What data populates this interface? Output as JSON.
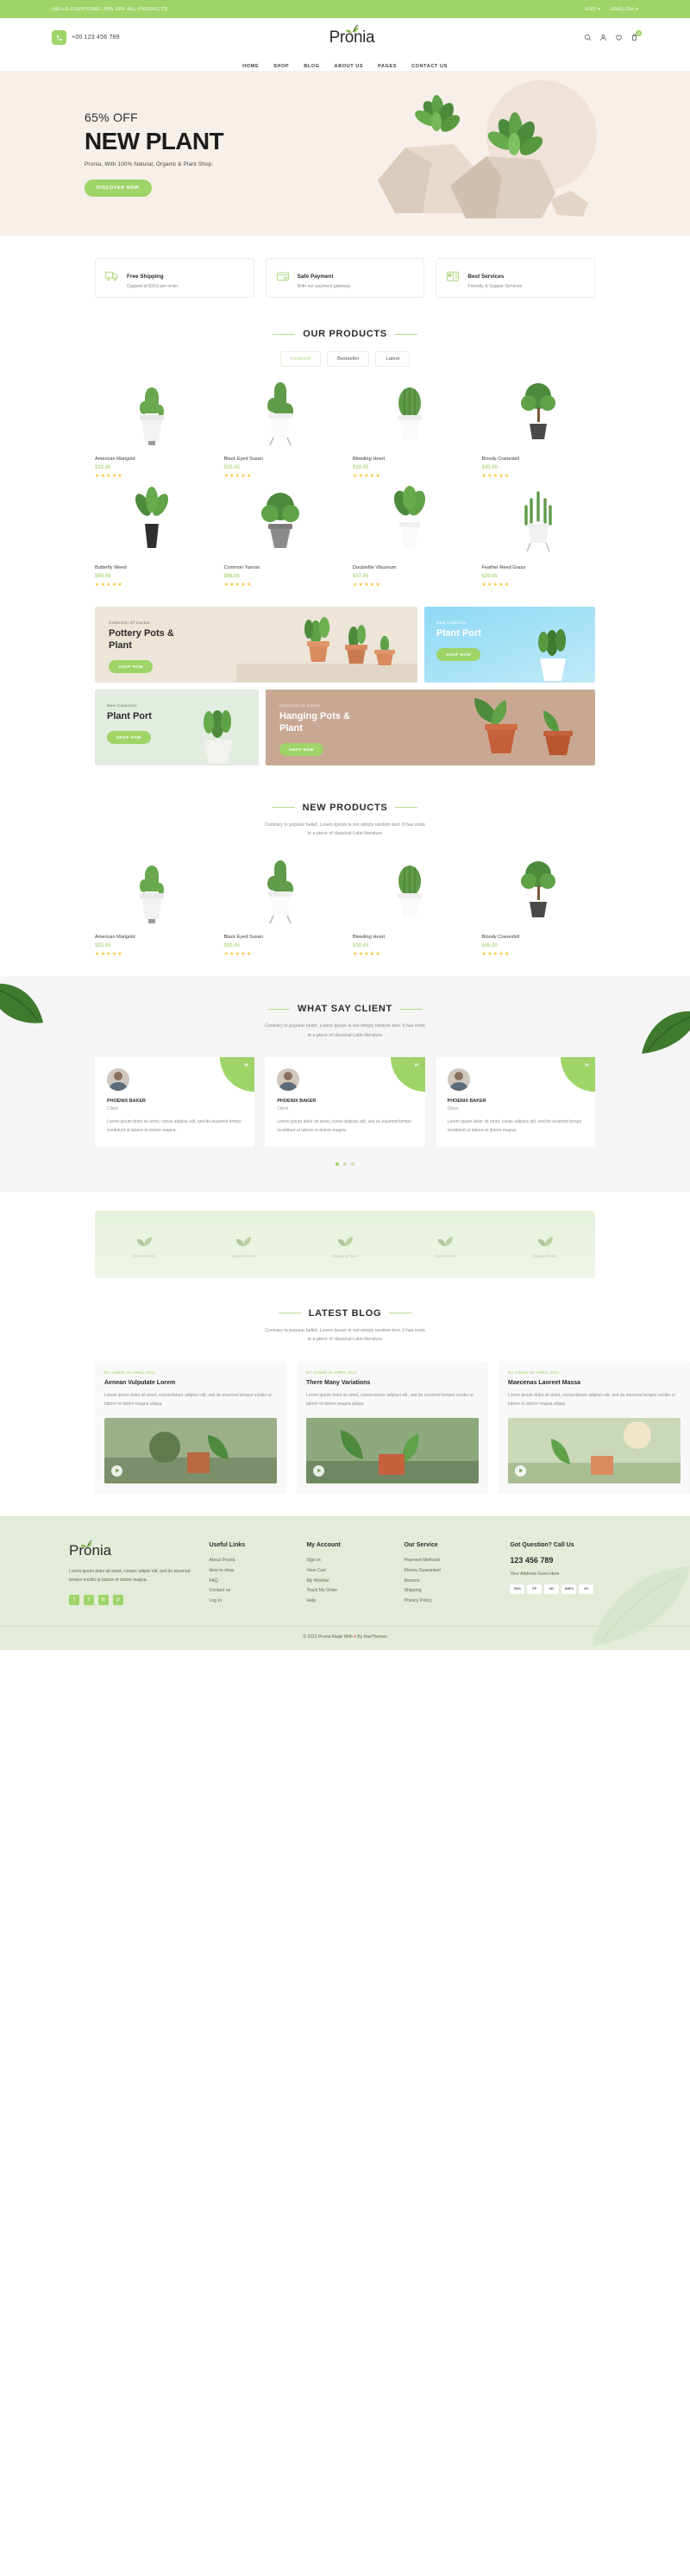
{
  "topbar": {
    "announcement": "HELLO EVERYONE! 25% OFF ALL PRODUCTS",
    "currency": "USD",
    "language": "ENGLISH",
    "caret": "▾"
  },
  "header": {
    "phone": "+00 123 456 789",
    "logo": "Pronia",
    "cart_count": "0",
    "icons": [
      "search-icon",
      "user-icon",
      "wishlist-icon",
      "cart-icon"
    ]
  },
  "nav": {
    "items": [
      {
        "label": "HOME"
      },
      {
        "label": "SHOP"
      },
      {
        "label": "BLOG"
      },
      {
        "label": "ABOUT US"
      },
      {
        "label": "PAGES"
      },
      {
        "label": "CONTACT US"
      }
    ]
  },
  "hero": {
    "offer": "65% OFF",
    "title": "NEW PLANT",
    "subtitle": "Pronia, With 100% Natural, Organic & Plant Shop.",
    "cta": "DISCOVER NOW",
    "bg": "#f7efe9"
  },
  "services": [
    {
      "icon": "truck-icon",
      "title": "Free Shipping",
      "desc": "Capped at $319 per order"
    },
    {
      "icon": "credit-card-icon",
      "title": "Safe Payment",
      "desc": "With our payment gateway"
    },
    {
      "icon": "support-icon",
      "title": "Best Services",
      "desc": "Friendly & Supper Services"
    }
  ],
  "products_section": {
    "title": "OUR PRODUCTS",
    "tabs": [
      {
        "label": "Featured",
        "active": true
      },
      {
        "label": "Bestseller",
        "active": false
      },
      {
        "label": "Latest",
        "active": false
      }
    ],
    "items": [
      {
        "name": "American Marigold",
        "price": "$23.45",
        "stars": "★★★★★"
      },
      {
        "name": "Black Eyed Susan",
        "price": "$25.45",
        "stars": "★★★★★"
      },
      {
        "name": "Bleeding Heart",
        "price": "$30.45",
        "stars": "★★★★★"
      },
      {
        "name": "Bloody Cranesbill",
        "price": "$45.00",
        "stars": "★★★★★"
      },
      {
        "name": "Butterfly Weed",
        "price": "$60.45",
        "stars": "★★★★★"
      },
      {
        "name": "Common Yarrow",
        "price": "$68.05",
        "stars": "★★★★★"
      },
      {
        "name": "Doublefile Viburnum",
        "price": "$47.45",
        "stars": "★★★★★"
      },
      {
        "name": "Feather Reed Grass",
        "price": "$20.05",
        "stars": "★★★★★"
      }
    ]
  },
  "banners": [
    {
      "eyebrow": "Collection Of Cactus",
      "title": "Pottery Pots &\nPlant",
      "cta": "SHOP NOW"
    },
    {
      "eyebrow": "New Collection",
      "title": "Plant Port",
      "cta": "SHOP NOW"
    },
    {
      "eyebrow": "New Collection",
      "title": "Plant Port",
      "cta": "SHOP NOW"
    },
    {
      "eyebrow": "Collection Of Cactus",
      "title": "Hanging Pots &\nPlant",
      "cta": "SHOP NOW"
    }
  ],
  "new_products": {
    "title": "NEW PRODUCTS",
    "desc_line1": "Contrary to popular belief, Lorem Ipsum is not simply random text. It has roots",
    "desc_line2": "in a piece of classical Latin literature",
    "items": [
      {
        "name": "American Marigold",
        "price": "$23.45",
        "stars": "★★★★★"
      },
      {
        "name": "Black Eyed Susan",
        "price": "$20.45",
        "stars": "★★★★★"
      },
      {
        "name": "Bleeding Heart",
        "price": "$30.45",
        "stars": "★★★★★"
      },
      {
        "name": "Bloody Cranesbill",
        "price": "$45.00",
        "stars": "★★★★★"
      }
    ]
  },
  "testimonials": {
    "title": "WHAT SAY CLIENT",
    "desc_line1": "Contrary to popular belief, Lorem Ipsum is not simply random text. It has roots",
    "desc_line2": "in a piece of classical Latin literature",
    "quote_mark": "”",
    "items": [
      {
        "name": "PHOENIX BAKER",
        "role": "Client",
        "text": "Lorem ipsum dolor sit amet, conse adipisic elit, sed do eiusmod tempo incididunt ut labore et dolore magna."
      },
      {
        "name": "PHOENIX BAKER",
        "role": "Client",
        "text": "Lorem ipsum dolor sit amet, conse adipisic elit, sed do eiusmod tempo incididunt ut labore et dolore magna."
      },
      {
        "name": "PHOENIX BAKER",
        "role": "Client",
        "text": "Lorem ipsum dolor sit amet, conse adipisic elit, sed do eiusmod tempo incididunt ut labore et dolore magna."
      }
    ]
  },
  "brands": [
    {
      "name": "GreenPlant"
    },
    {
      "name": "GardenPlant"
    },
    {
      "name": "GrowingPlant"
    },
    {
      "name": "GreenPlant"
    },
    {
      "name": "GrapesPlant"
    }
  ],
  "blog": {
    "title": "LATEST BLOG",
    "desc_line1": "Contrary to popular belief, Lorem Ipsum is not simply random text. It has roots",
    "desc_line2": "in a piece of classical Latin literature",
    "posts": [
      {
        "meta": "BY ADMIN   04 APRIL 2021",
        "title": "Aenean Vulputate Lorem",
        "excerpt": "Lorem ipsum dolor sit amet, consectetuer adipisci elit, sed do eiusmod tempor incidio ut labore et dolore magna aliqua."
      },
      {
        "meta": "BY ADMIN   04 APRIL 2021",
        "title": "There Many Variations",
        "excerpt": "Lorem ipsum dolor sit amet, consectetuer adipisci elit, sed do eiusmod tempor incidio ut labore et dolore magna aliqua."
      },
      {
        "meta": "BY ADMIN   04 APRIL 2021",
        "title": "Maecenas Laoreet Massa",
        "excerpt": "Lorem ipsum dolor sit amet, consectetuer adipisci elit, sed do eiusmod tempor incidio ut labore et dolore magna aliqua."
      }
    ]
  },
  "footer": {
    "logo": "Pronia",
    "about": "Lorem ipsum dolor sit amet, consec adipisi elit, sed do eiusmod tempor incidio ut labore et dolore magna.",
    "social": [
      "f",
      "t",
      "in",
      "p"
    ],
    "columns": [
      {
        "heading": "Useful Links",
        "links": [
          "About Pronia",
          "How to shop",
          "FAQ",
          "Contact us",
          "Log In"
        ]
      },
      {
        "heading": "My Account",
        "links": [
          "Sign In",
          "View Cart",
          "My Wishlist",
          "Track My Order",
          "Help"
        ]
      },
      {
        "heading": "Our Service",
        "links": [
          "Payment Methods",
          "Money Guarantee!",
          "Returns",
          "Shipping",
          "Privacy Policy"
        ]
      }
    ],
    "contact": {
      "heading": "Got Question? Call Us",
      "phone": "123 456 789",
      "address": "Your Address Goes Here",
      "cards": [
        "VISA",
        "PP",
        "MC",
        "AMEX",
        "DC"
      ]
    },
    "copyright_pre": "© 2021 Pronia Made With ",
    "copyright_heart": "♥",
    "copyright_post": " By HasThemes"
  },
  "colors": {
    "green": "#9fd468",
    "green_light": "#b5d98a",
    "hero_bg": "#f7efe9",
    "footer_bg": "#e2ecd9",
    "star": "#fbc531"
  }
}
